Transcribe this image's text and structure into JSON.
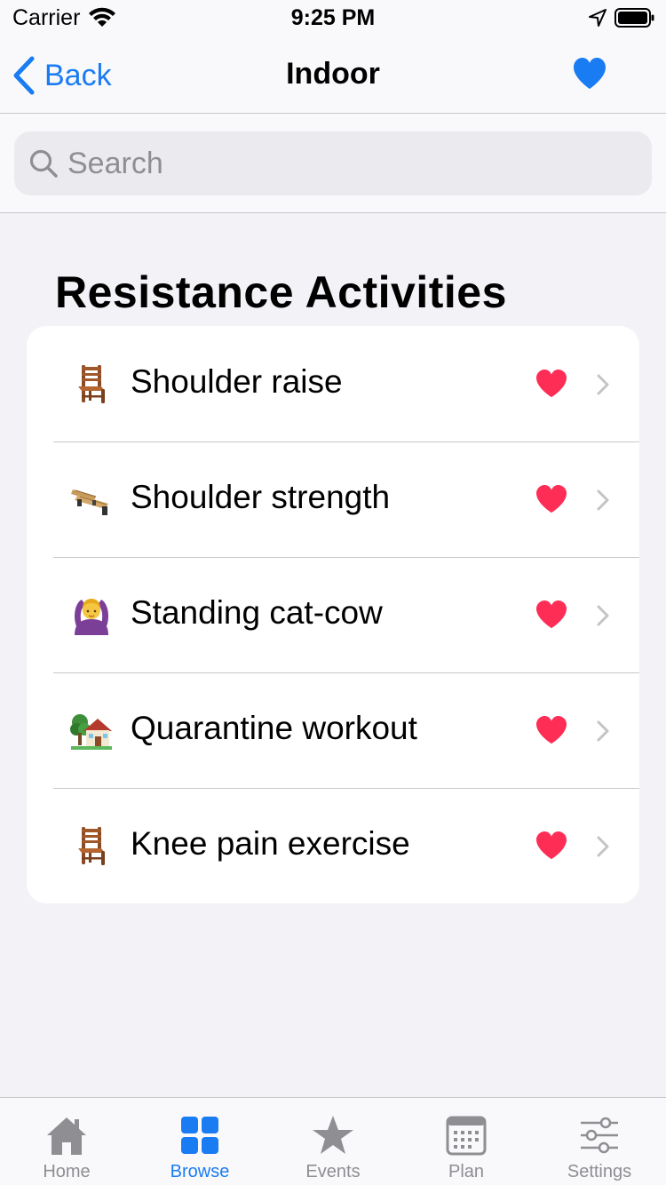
{
  "status_bar": {
    "carrier": "Carrier",
    "time": "9:25 PM"
  },
  "nav": {
    "back_label": "Back",
    "title": "Indoor"
  },
  "search": {
    "placeholder": "Search",
    "value": ""
  },
  "section": {
    "title": "Resistance Activities"
  },
  "activities": [
    {
      "label": "Shoulder raise",
      "icon": "chair-icon"
    },
    {
      "label": "Shoulder strength",
      "icon": "bench-icon"
    },
    {
      "label": "Standing cat-cow",
      "icon": "person-arms-up-icon"
    },
    {
      "label": "Quarantine workout",
      "icon": "house-with-tree-icon"
    },
    {
      "label": "Knee pain exercise",
      "icon": "chair-icon"
    }
  ],
  "tabs": [
    {
      "label": "Home",
      "icon": "home-icon",
      "active": false
    },
    {
      "label": "Browse",
      "icon": "grid-icon",
      "active": true
    },
    {
      "label": "Events",
      "icon": "star-icon",
      "active": false
    },
    {
      "label": "Plan",
      "icon": "calendar-icon",
      "active": false
    },
    {
      "label": "Settings",
      "icon": "sliders-icon",
      "active": false
    }
  ],
  "colors": {
    "accent": "#1a7cf2",
    "heart": "#fe2d55",
    "inactive": "#8e8e93",
    "background": "#f2f2f7"
  }
}
